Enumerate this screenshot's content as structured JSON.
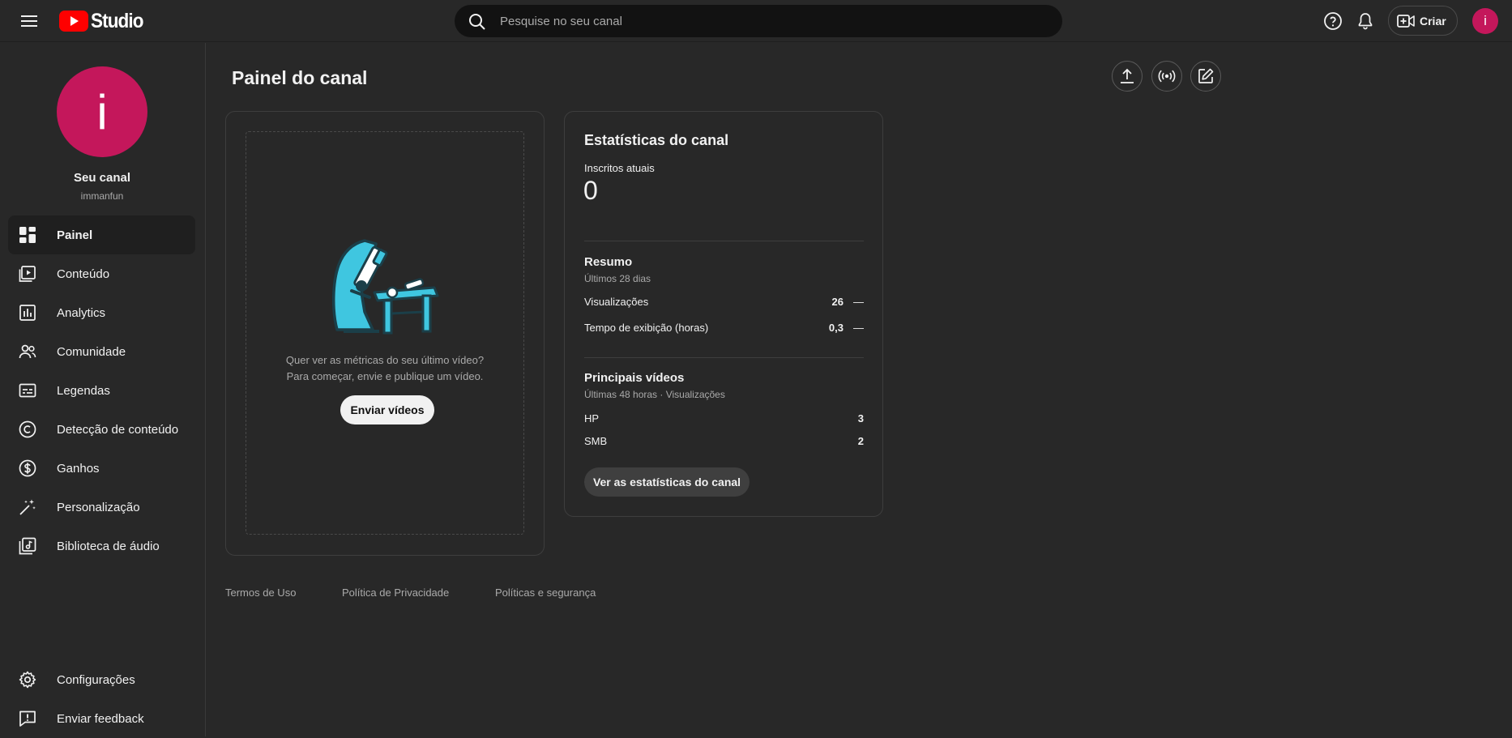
{
  "header": {
    "logo_text": "Studio",
    "search_placeholder": "Pesquise no seu canal",
    "create_label": "Criar",
    "avatar_letter": "i"
  },
  "sidebar": {
    "avatar_letter": "i",
    "channel_name": "Seu canal",
    "channel_handle": "immanfun",
    "items": [
      {
        "label": "Painel",
        "icon": "dashboard-icon",
        "active": true
      },
      {
        "label": "Conteúdo",
        "icon": "content-icon"
      },
      {
        "label": "Analytics",
        "icon": "analytics-icon"
      },
      {
        "label": "Comunidade",
        "icon": "community-icon"
      },
      {
        "label": "Legendas",
        "icon": "subtitles-icon"
      },
      {
        "label": "Detecção de conteúdo",
        "icon": "copyright-icon"
      },
      {
        "label": "Ganhos",
        "icon": "earn-icon"
      },
      {
        "label": "Personalização",
        "icon": "customization-icon"
      },
      {
        "label": "Biblioteca de áudio",
        "icon": "audio-library-icon"
      }
    ],
    "bottom_items": [
      {
        "label": "Configurações",
        "icon": "settings-icon"
      },
      {
        "label": "Enviar feedback",
        "icon": "feedback-icon"
      }
    ]
  },
  "main": {
    "page_title": "Painel do canal",
    "empty_card": {
      "line1": "Quer ver as métricas do seu último vídeo?",
      "line2": "Para começar, envie e publique um vídeo.",
      "button": "Enviar vídeos"
    },
    "stats_card": {
      "title": "Estatísticas do canal",
      "subscribers_label": "Inscritos atuais",
      "subscribers_value": "0",
      "summary_title": "Resumo",
      "summary_period": "Últimos 28 dias",
      "summary_rows": [
        {
          "label": "Visualizações",
          "value": "26",
          "trend": "—"
        },
        {
          "label": "Tempo de exibição (horas)",
          "value": "0,3",
          "trend": "—"
        }
      ],
      "top_title": "Principais vídeos",
      "top_period": "Últimas 48 horas · Visualizações",
      "top_rows": [
        {
          "label": "HP",
          "value": "3"
        },
        {
          "label": "SMB",
          "value": "2"
        }
      ],
      "button": "Ver as estatísticas do canal"
    }
  },
  "footer": {
    "links": [
      "Termos de Uso",
      "Política de Privacidade",
      "Políticas e segurança"
    ]
  },
  "colors": {
    "background": "#282828",
    "accent_avatar": "#c4175b",
    "brand_red": "#ff0000",
    "illustration_cyan": "#3fc6e0"
  }
}
